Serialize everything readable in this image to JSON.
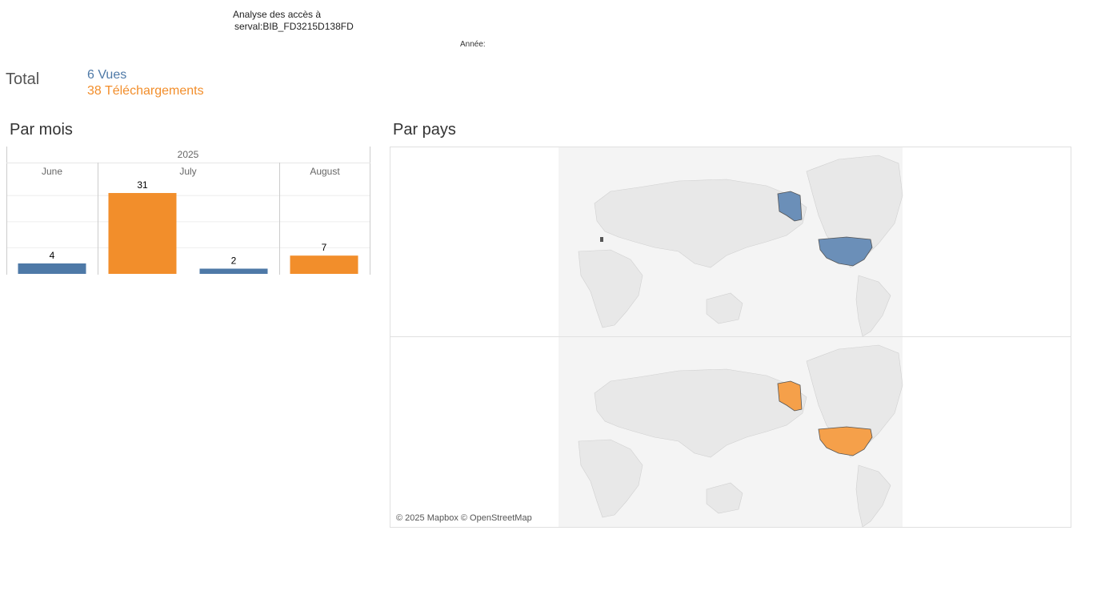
{
  "header": {
    "title_line1": "Analyse des accès à",
    "title_line2": "serval:BIB_FD3215D138FD",
    "year_filter_label": "Année:"
  },
  "totals": {
    "label": "Total",
    "views": "6 Vues",
    "downloads": "38 Téléchargements"
  },
  "sections": {
    "by_month": "Par mois",
    "by_country": "Par pays"
  },
  "colors": {
    "views": "#4e79a7",
    "downloads": "#f28e2b",
    "map_land": "#e8e8e8",
    "map_highlight_views": "#6b8fb8",
    "map_highlight_downloads": "#f5a04a"
  },
  "chart_data": {
    "type": "bar",
    "year": "2025",
    "categories": [
      "June",
      "July",
      "August"
    ],
    "series": [
      {
        "name": "Vues",
        "values": [
          4,
          2,
          0
        ]
      },
      {
        "name": "Téléchargements",
        "values": [
          0,
          31,
          7
        ]
      }
    ],
    "ylim": [
      0,
      35
    ],
    "grid": true
  },
  "maps": {
    "attribution": "© 2025 Mapbox © OpenStreetMap"
  }
}
